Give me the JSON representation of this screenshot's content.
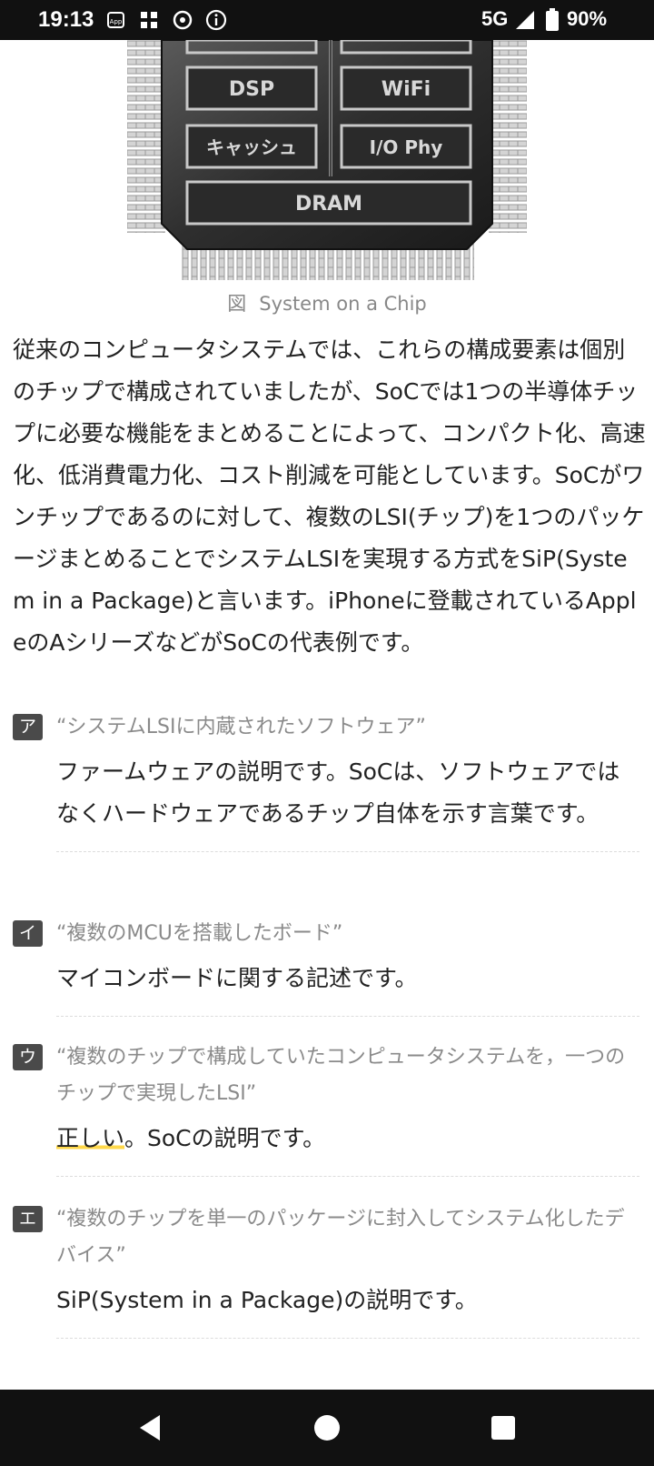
{
  "status_bar": {
    "time": "19:13",
    "network": "5G",
    "battery": "90%",
    "notification_icons": [
      "app-store-icon",
      "widgets-icon",
      "assistant-icon",
      "info-icon"
    ]
  },
  "figure": {
    "chip_blocks": {
      "dsp": "DSP",
      "wifi": "WiFi",
      "cache": "キャッシュ",
      "io_phy": "I/O Phy",
      "dram": "DRAM"
    },
    "caption_prefix": "図",
    "caption": "System on a Chip"
  },
  "body_paragraph": "従来のコンピュータシステムでは、これらの構成要素は個別のチップで構成されていましたが、SoCでは1つの半導体チップに必要な機能をまとめることによって、コンパクト化、高速化、低消費電力化、コスト削減を可能としています。SoCがワンチップであるのに対して、複数のLSI(チップ)を1つのパッケージまとめることでシステムLSIを実現する方式をSiP(System in a Package)と言います。iPhoneに登載されているAppleのAシリーズなどがSoCの代表例です。",
  "choices": [
    {
      "badge": "ア",
      "quote": "“システムLSIに内蔵されたソフトウェア”",
      "answer": "ファームウェアの説明です。SoCは、ソフトウェアではなくハードウェアであるチップ自体を示す言葉です。"
    },
    {
      "badge": "イ",
      "quote": "“複数のMCUを搭載したボード”",
      "answer": "マイコンボードに関する記述です。"
    },
    {
      "badge": "ウ",
      "quote": "“複数のチップで構成していたコンピュータシステムを，一つのチップで実現したLSI”",
      "answer_highlight": "正しい",
      "answer_rest": "。SoCの説明です。"
    },
    {
      "badge": "エ",
      "quote": "“複数のチップを単一のパッケージに封入してシステム化したデバイス”",
      "answer": "SiP(System in a Package)の説明です。"
    }
  ],
  "colors": {
    "status_bar_bg": "#111111",
    "badge_bg": "#4a4a4a",
    "quote_text": "#8a8a8a",
    "highlight": "#ffd84a"
  }
}
